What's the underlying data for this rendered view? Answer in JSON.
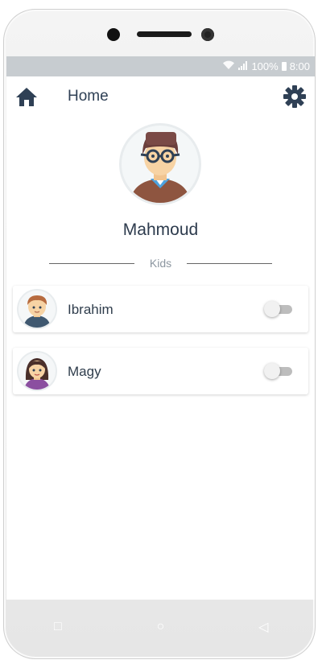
{
  "status_bar": {
    "battery": "100%",
    "time": "8:00"
  },
  "app_bar": {
    "title": "Home"
  },
  "profile": {
    "name": "Mahmoud"
  },
  "section": {
    "label": "Kids"
  },
  "kids": [
    {
      "name": "Ibrahim",
      "enabled": false
    },
    {
      "name": "Magy",
      "enabled": false
    }
  ],
  "icons": {
    "home": "home-icon",
    "settings": "gear-icon",
    "nav_recent": "square-icon",
    "nav_home": "circle-icon",
    "nav_back": "triangle-back-icon"
  },
  "nav_glyphs": {
    "recent": "□",
    "home": "○",
    "back": "◁"
  },
  "colors": {
    "accent": "#2f4055",
    "status_bar": "#c7ccd0",
    "text_primary": "#2d3b4d",
    "toggle_off": "#bdbdbd"
  }
}
